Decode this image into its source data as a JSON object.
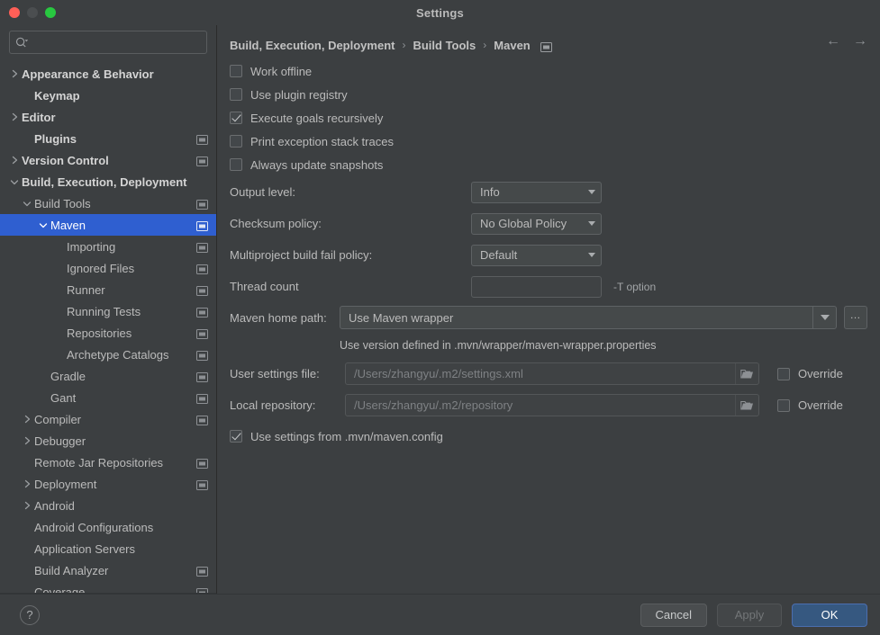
{
  "window": {
    "title": "Settings",
    "traffic_lights": [
      "close-button",
      "minimize-button",
      "zoom-button"
    ]
  },
  "sidebar": {
    "search": {
      "value": "",
      "placeholder": ""
    },
    "items": [
      {
        "label": "Appearance & Behavior",
        "depth": 0,
        "arrow": "right",
        "bold": true,
        "proj_icon": false,
        "selected": false
      },
      {
        "label": "Keymap",
        "depth": 1,
        "arrow": "none",
        "bold": true,
        "proj_icon": false,
        "selected": false
      },
      {
        "label": "Editor",
        "depth": 0,
        "arrow": "right",
        "bold": true,
        "proj_icon": false,
        "selected": false
      },
      {
        "label": "Plugins",
        "depth": 1,
        "arrow": "none",
        "bold": true,
        "proj_icon": true,
        "selected": false
      },
      {
        "label": "Version Control",
        "depth": 0,
        "arrow": "right",
        "bold": true,
        "proj_icon": true,
        "selected": false
      },
      {
        "label": "Build, Execution, Deployment",
        "depth": 0,
        "arrow": "down",
        "bold": true,
        "proj_icon": false,
        "selected": false
      },
      {
        "label": "Build Tools",
        "depth": 1,
        "arrow": "down",
        "bold": false,
        "proj_icon": true,
        "selected": false
      },
      {
        "label": "Maven",
        "depth": 2,
        "arrow": "down",
        "bold": false,
        "proj_icon": true,
        "selected": true
      },
      {
        "label": "Importing",
        "depth": 3,
        "arrow": "none",
        "bold": false,
        "proj_icon": true,
        "selected": false
      },
      {
        "label": "Ignored Files",
        "depth": 3,
        "arrow": "none",
        "bold": false,
        "proj_icon": true,
        "selected": false
      },
      {
        "label": "Runner",
        "depth": 3,
        "arrow": "none",
        "bold": false,
        "proj_icon": true,
        "selected": false
      },
      {
        "label": "Running Tests",
        "depth": 3,
        "arrow": "none",
        "bold": false,
        "proj_icon": true,
        "selected": false
      },
      {
        "label": "Repositories",
        "depth": 3,
        "arrow": "none",
        "bold": false,
        "proj_icon": true,
        "selected": false
      },
      {
        "label": "Archetype Catalogs",
        "depth": 3,
        "arrow": "none",
        "bold": false,
        "proj_icon": true,
        "selected": false
      },
      {
        "label": "Gradle",
        "depth": 2,
        "arrow": "none",
        "bold": false,
        "proj_icon": true,
        "selected": false
      },
      {
        "label": "Gant",
        "depth": 2,
        "arrow": "none",
        "bold": false,
        "proj_icon": true,
        "selected": false
      },
      {
        "label": "Compiler",
        "depth": 1,
        "arrow": "right",
        "bold": false,
        "proj_icon": true,
        "selected": false
      },
      {
        "label": "Debugger",
        "depth": 1,
        "arrow": "right",
        "bold": false,
        "proj_icon": false,
        "selected": false
      },
      {
        "label": "Remote Jar Repositories",
        "depth": 1,
        "arrow": "none",
        "bold": false,
        "proj_icon": true,
        "selected": false
      },
      {
        "label": "Deployment",
        "depth": 1,
        "arrow": "right",
        "bold": false,
        "proj_icon": true,
        "selected": false
      },
      {
        "label": "Android",
        "depth": 1,
        "arrow": "right",
        "bold": false,
        "proj_icon": false,
        "selected": false
      },
      {
        "label": "Android Configurations",
        "depth": 1,
        "arrow": "none",
        "bold": false,
        "proj_icon": false,
        "selected": false
      },
      {
        "label": "Application Servers",
        "depth": 1,
        "arrow": "none",
        "bold": false,
        "proj_icon": false,
        "selected": false
      },
      {
        "label": "Build Analyzer",
        "depth": 1,
        "arrow": "none",
        "bold": false,
        "proj_icon": true,
        "selected": false
      },
      {
        "label": "Coverage",
        "depth": 1,
        "arrow": "none",
        "bold": false,
        "proj_icon": true,
        "selected": false
      }
    ]
  },
  "main": {
    "breadcrumb": {
      "parts": [
        "Build, Execution, Deployment",
        "Build Tools",
        "Maven"
      ],
      "separator": "›"
    },
    "nav": {
      "back": "←",
      "forward": "→"
    },
    "checkboxes": [
      {
        "label": "Work offline",
        "checked": false
      },
      {
        "label": "Use plugin registry",
        "checked": false
      },
      {
        "label": "Execute goals recursively",
        "checked": true
      },
      {
        "label": "Print exception stack traces",
        "checked": false
      },
      {
        "label": "Always update snapshots",
        "checked": false
      }
    ],
    "fields": [
      {
        "label": "Output level:",
        "value": "Info",
        "kind": "combo"
      },
      {
        "label": "Checksum policy:",
        "value": "No Global Policy",
        "kind": "combo"
      },
      {
        "label": "Multiproject build fail policy:",
        "value": "Default",
        "kind": "combo"
      }
    ],
    "thread_count": {
      "label": "Thread count",
      "value": "",
      "note": "-T option"
    },
    "maven_home": {
      "label": "Maven home path:",
      "value": "Use Maven wrapper",
      "browse_label": "…",
      "hint": "Use version defined in .mvn/wrapper/maven-wrapper.properties"
    },
    "paths": [
      {
        "label": "User settings file:",
        "value": "/Users/zhangyu/.m2/settings.xml",
        "override_label": "Override",
        "override_checked": false
      },
      {
        "label": "Local repository:",
        "value": "/Users/zhangyu/.m2/repository",
        "override_label": "Override",
        "override_checked": false
      }
    ],
    "config_checkbox": {
      "label": "Use settings from .mvn/maven.config",
      "checked": true
    }
  },
  "footer": {
    "help_label": "?",
    "buttons": [
      {
        "label": "Cancel",
        "style": "normal"
      },
      {
        "label": "Apply",
        "style": "disabled"
      },
      {
        "label": "OK",
        "style": "primary"
      }
    ]
  },
  "colors": {
    "background": "#3c3f41",
    "selection": "#2f5fd0",
    "primary_button": "#365880",
    "text": "#bbbbbb",
    "muted_text": "#7e8184"
  }
}
